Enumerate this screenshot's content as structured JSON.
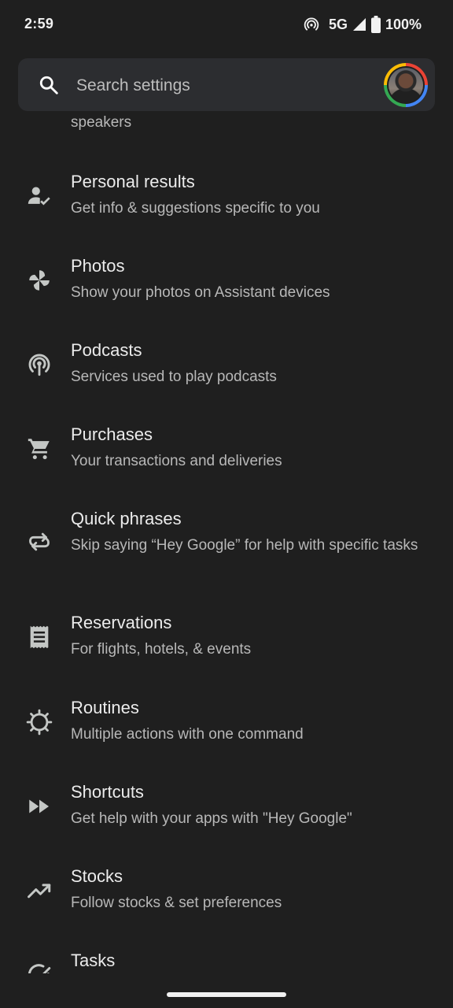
{
  "status_bar": {
    "time": "2:59",
    "network": "5G",
    "battery": "100%"
  },
  "search": {
    "placeholder": "Search settings"
  },
  "list": {
    "partial_subtitle": "speakers",
    "items": [
      {
        "title": "Personal results",
        "subtitle": "Get info & suggestions specific to you",
        "icon": "person-check-icon"
      },
      {
        "title": "Photos",
        "subtitle": "Show your photos on Assistant devices",
        "icon": "pinwheel-icon"
      },
      {
        "title": "Podcasts",
        "subtitle": "Services used to play podcasts",
        "icon": "podcast-icon"
      },
      {
        "title": "Purchases",
        "subtitle": "Your transactions and deliveries",
        "icon": "cart-icon"
      },
      {
        "title": "Quick phrases",
        "subtitle": "Skip saying “Hey Google” for help with specific tasks",
        "icon": "repeat-icon"
      },
      {
        "title": "Reservations",
        "subtitle": "For flights, hotels, & events",
        "icon": "receipt-icon"
      },
      {
        "title": "Routines",
        "subtitle": "Multiple actions with one command",
        "icon": "routine-icon"
      },
      {
        "title": "Shortcuts",
        "subtitle": "Get help with your apps with \"Hey Google\"",
        "icon": "fast-forward-icon"
      },
      {
        "title": "Stocks",
        "subtitle": "Follow stocks & set preferences",
        "icon": "trending-up-icon"
      },
      {
        "title": "Tasks",
        "subtitle": "",
        "icon": "task-check-icon"
      }
    ]
  },
  "colors": {
    "background": "#1f1f1f",
    "search_background": "#2c2d30",
    "title_text": "#ececec",
    "subtitle_text": "#b8b8b8",
    "icon": "#c4c7c5"
  }
}
